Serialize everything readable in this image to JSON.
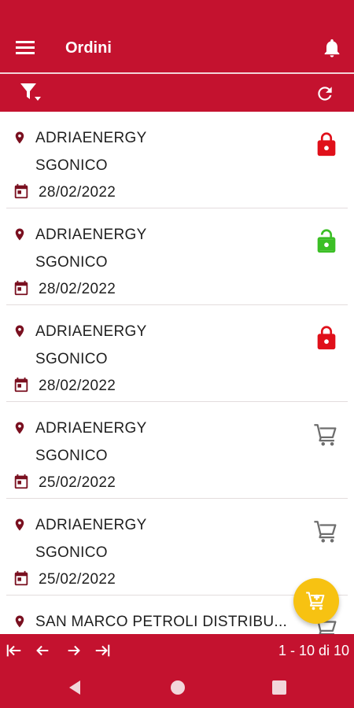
{
  "appbar": {
    "title": "Ordini"
  },
  "pager": {
    "range_text": "1 - 10 di 10"
  },
  "orders": [
    {
      "customer": "ADRIAENERGY",
      "location": "SGONICO",
      "date": "28/02/2022",
      "status": "locked"
    },
    {
      "customer": "ADRIAENERGY",
      "location": "SGONICO",
      "date": "28/02/2022",
      "status": "unlocked"
    },
    {
      "customer": "ADRIAENERGY",
      "location": "SGONICO",
      "date": "28/02/2022",
      "status": "locked"
    },
    {
      "customer": "ADRIAENERGY",
      "location": "SGONICO",
      "date": "25/02/2022",
      "status": "cart"
    },
    {
      "customer": "ADRIAENERGY",
      "location": "SGONICO",
      "date": "25/02/2022",
      "status": "cart"
    },
    {
      "customer": "SAN MARCO PETROLI DISTRIBU...",
      "status": "cart"
    }
  ],
  "colors": {
    "primary": "#c4122f",
    "lock_locked": "#e0101a",
    "lock_unlocked": "#3bbf25",
    "cart": "#6d6d6d",
    "fab": "#f7c212",
    "icon_dark": "#7a1020"
  }
}
